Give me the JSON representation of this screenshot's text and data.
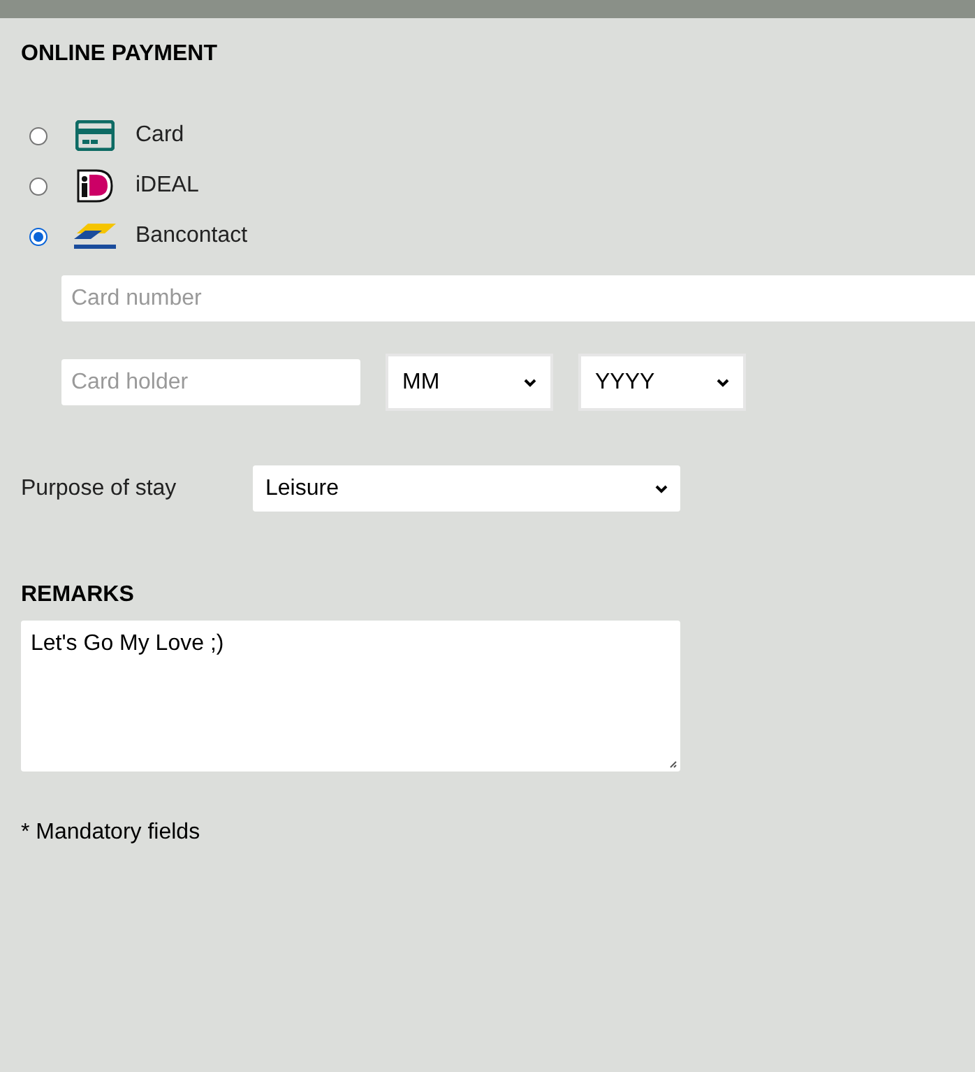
{
  "section_title": "ONLINE PAYMENT",
  "payment_methods": [
    {
      "label": "Card",
      "kind": "card",
      "selected": false
    },
    {
      "label": "iDEAL",
      "kind": "ideal",
      "selected": false
    },
    {
      "label": "Bancontact",
      "kind": "bancontact",
      "selected": true
    }
  ],
  "card_number": {
    "placeholder": "Card number"
  },
  "card_holder": {
    "placeholder": "Card holder"
  },
  "expiry_month": {
    "value": "MM"
  },
  "expiry_year": {
    "value": "YYYY"
  },
  "purpose": {
    "label": "Purpose of stay",
    "value": "Leisure"
  },
  "remarks": {
    "title": "REMARKS",
    "value": "Let's Go My Love ;)"
  },
  "footnote": "* Mandatory fields"
}
